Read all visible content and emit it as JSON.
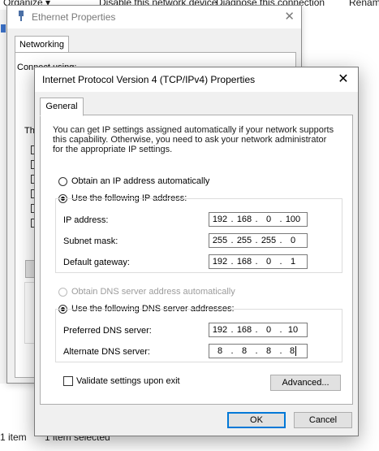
{
  "explorer": {
    "toolbar": [
      "Organize ▾",
      "Disable this network device",
      "Diagnose this connection",
      "Renam"
    ],
    "status_count": "1 item",
    "status_selected": "1 item selected"
  },
  "ethernet_window": {
    "title": "Ethernet Properties",
    "tab": "Networking",
    "connect_using_label": "Connect using:",
    "items_label_fragment": "Th"
  },
  "dialog": {
    "title": "Internet Protocol Version 4 (TCP/IPv4) Properties",
    "tab": "General",
    "intro": "You can get IP settings assigned automatically if your network supports\nthis capability. Otherwise, you need to ask your network administrator\nfor the appropriate IP settings.",
    "ip": {
      "auto_label": "Obtain an IP address automatically",
      "manual_label": "Use the following IP address:",
      "address_label": "IP address:",
      "address": [
        "192",
        "168",
        "0",
        "100"
      ],
      "subnet_label": "Subnet mask:",
      "subnet": [
        "255",
        "255",
        "255",
        "0"
      ],
      "gateway_label": "Default gateway:",
      "gateway": [
        "192",
        "168",
        "0",
        "1"
      ]
    },
    "dns": {
      "auto_label": "Obtain DNS server address automatically",
      "manual_label": "Use the following DNS server addresses:",
      "preferred_label": "Preferred DNS server:",
      "preferred": [
        "192",
        "168",
        "0",
        "10"
      ],
      "alternate_label": "Alternate DNS server:",
      "alternate": [
        "8",
        "8",
        "8",
        "8"
      ]
    },
    "validate_label": "Validate settings upon exit",
    "advanced_label": "Advanced...",
    "ok_label": "OK",
    "cancel_label": "Cancel"
  }
}
